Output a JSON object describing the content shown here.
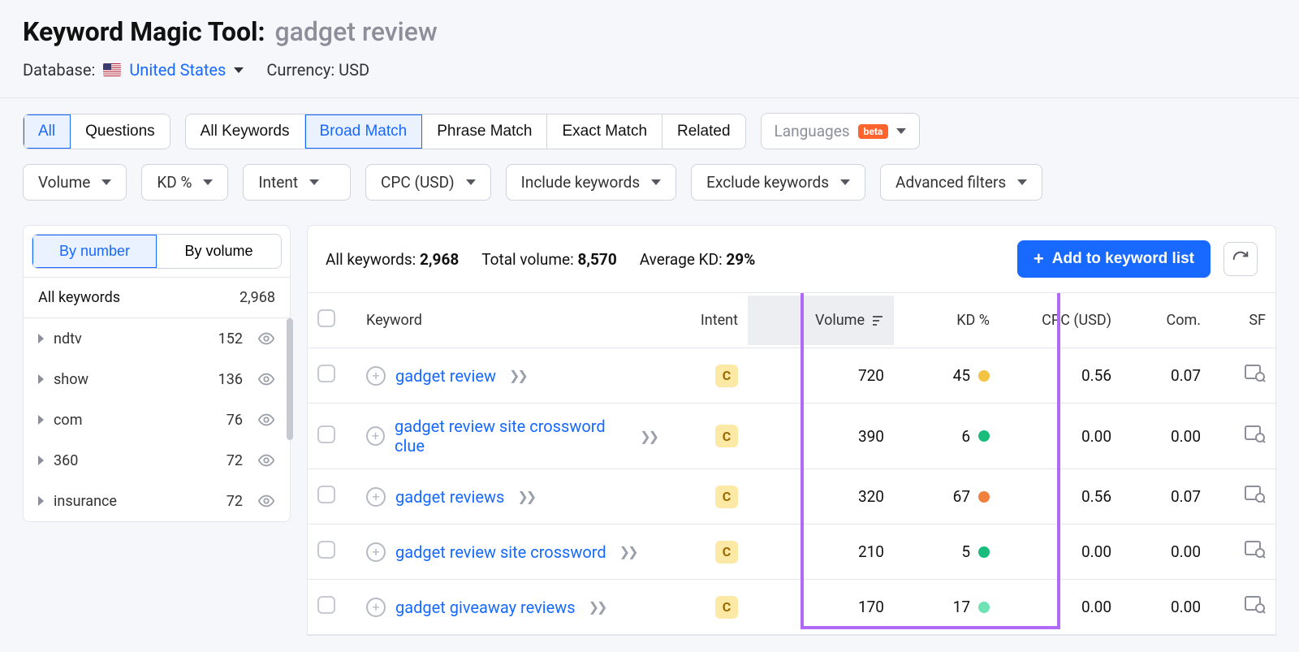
{
  "header": {
    "title": "Keyword Magic Tool:",
    "query": "gadget review",
    "db_label": "Database:",
    "db_value": "United States",
    "currency_label": "Currency:",
    "currency_value": "USD"
  },
  "seg_primary": {
    "all": "All",
    "questions": "Questions"
  },
  "seg_match": {
    "all": "All Keywords",
    "broad": "Broad Match",
    "phrase": "Phrase Match",
    "exact": "Exact Match",
    "related": "Related"
  },
  "languages": {
    "label": "Languages",
    "beta": "beta"
  },
  "filters": {
    "volume": "Volume",
    "kd": "KD %",
    "intent": "Intent",
    "cpc": "CPC (USD)",
    "include": "Include keywords",
    "exclude": "Exclude keywords",
    "advanced": "Advanced filters"
  },
  "sidebar": {
    "by_number": "By number",
    "by_volume": "By volume",
    "header_label": "All keywords",
    "header_count": "2,968",
    "items": [
      {
        "name": "ndtv",
        "count": "152"
      },
      {
        "name": "show",
        "count": "136"
      },
      {
        "name": "com",
        "count": "76"
      },
      {
        "name": "360",
        "count": "72"
      },
      {
        "name": "insurance",
        "count": "72"
      }
    ]
  },
  "summary": {
    "all_kw_label": "All keywords:",
    "all_kw_value": "2,968",
    "tot_vol_label": "Total volume:",
    "tot_vol_value": "8,570",
    "avg_kd_label": "Average KD:",
    "avg_kd_value": "29%",
    "add_btn": "Add to keyword list"
  },
  "columns": {
    "keyword": "Keyword",
    "intent": "Intent",
    "volume": "Volume",
    "kd": "KD %",
    "cpc": "CPC (USD)",
    "com": "Com.",
    "sf": "SF"
  },
  "intent_badge_letter": "C",
  "rows": [
    {
      "keyword": "gadget review",
      "intent": "C",
      "volume": "720",
      "kd": "45",
      "kd_color": "#f5c344",
      "cpc": "0.56",
      "com": "0.07"
    },
    {
      "keyword": "gadget review site crossword clue",
      "intent": "C",
      "volume": "390",
      "kd": "6",
      "kd_color": "#1abc7b",
      "cpc": "0.00",
      "com": "0.00"
    },
    {
      "keyword": "gadget reviews",
      "intent": "C",
      "volume": "320",
      "kd": "67",
      "kd_color": "#f0803c",
      "cpc": "0.56",
      "com": "0.07"
    },
    {
      "keyword": "gadget review site crossword",
      "intent": "C",
      "volume": "210",
      "kd": "5",
      "kd_color": "#1abc7b",
      "cpc": "0.00",
      "com": "0.00"
    },
    {
      "keyword": "gadget giveaway reviews",
      "intent": "C",
      "volume": "170",
      "kd": "17",
      "kd_color": "#6fe3b5",
      "cpc": "0.00",
      "com": "0.00"
    }
  ]
}
